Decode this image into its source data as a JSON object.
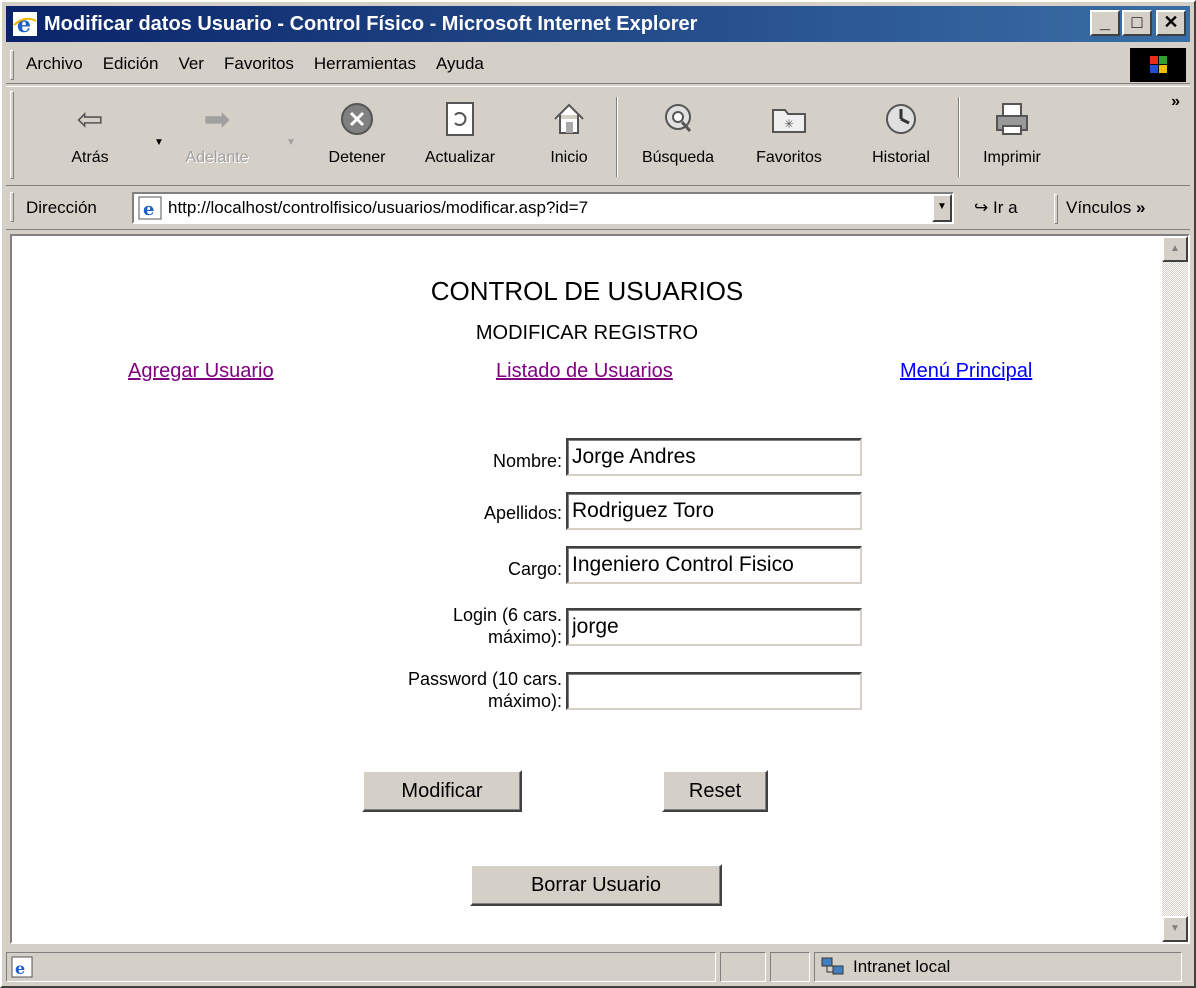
{
  "window": {
    "title": "Modificar datos Usuario - Control Físico - Microsoft Internet Explorer",
    "minimize": "_",
    "maximize": "□",
    "close": "✕"
  },
  "menu": {
    "items": [
      "Archivo",
      "Edición",
      "Ver",
      "Favoritos",
      "Herramientas",
      "Ayuda"
    ]
  },
  "toolbar": {
    "back": "Atrás",
    "forward": "Adelante",
    "stop": "Detener",
    "refresh": "Actualizar",
    "home": "Inicio",
    "search": "Búsqueda",
    "favorites": "Favoritos",
    "history": "Historial",
    "print": "Imprimir",
    "more": "»"
  },
  "address": {
    "label": "Dirección",
    "url": "http://localhost/controlfisico/usuarios/modificar.asp?id=7",
    "go": "Ir a",
    "links": "Vínculos",
    "links_more": "»"
  },
  "page": {
    "title": "CONTROL DE USUARIOS",
    "subtitle": "MODIFICAR REGISTRO",
    "links": {
      "add_user": "Agregar Usuario",
      "list_users": "Listado de Usuarios",
      "main_menu": "Menú Principal"
    },
    "form": {
      "nombre_label": "Nombre:",
      "nombre_value": "Jorge Andres",
      "apellidos_label": "Apellidos:",
      "apellidos_value": "Rodriguez Toro",
      "cargo_label": "Cargo:",
      "cargo_value": "Ingeniero Control Fisico",
      "login_label_1": "Login (6 cars.",
      "login_label_2": "máximo):",
      "login_value": "jorge",
      "password_label_1": "Password (10 cars.",
      "password_label_2": "máximo):",
      "password_value": ""
    },
    "buttons": {
      "modify": "Modificar",
      "reset": "Reset",
      "delete": "Borrar Usuario"
    }
  },
  "status": {
    "zone": "Intranet local"
  }
}
